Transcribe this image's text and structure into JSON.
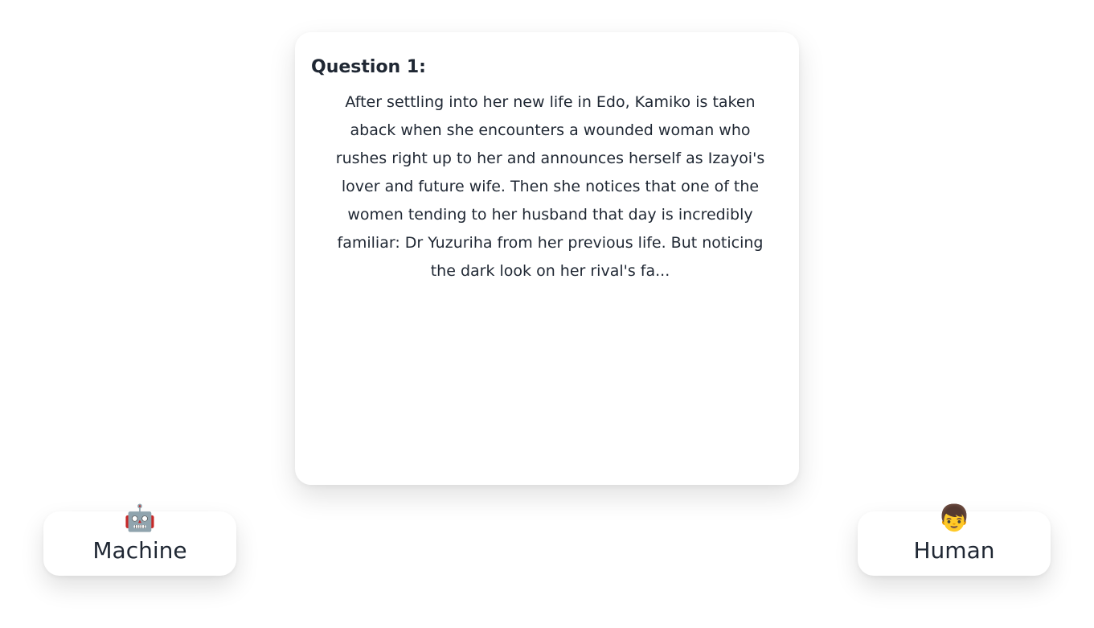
{
  "question": {
    "title": "Question 1:",
    "text": "After settling into her new life in Edo, Kamiko is taken aback when she encounters a wounded woman who rushes right up to her and announces herself as Izayoi's lover and future wife. Then she notices that one of the women tending to her husband that day is incredibly familiar: Dr Yuzuriha from her previous life. But noticing the dark look on her rival's fa..."
  },
  "choices": {
    "machine": {
      "icon": "robot-icon",
      "emoji": "🤖",
      "label": "Machine"
    },
    "human": {
      "icon": "boy-icon",
      "emoji": "👦",
      "label": "Human"
    }
  }
}
